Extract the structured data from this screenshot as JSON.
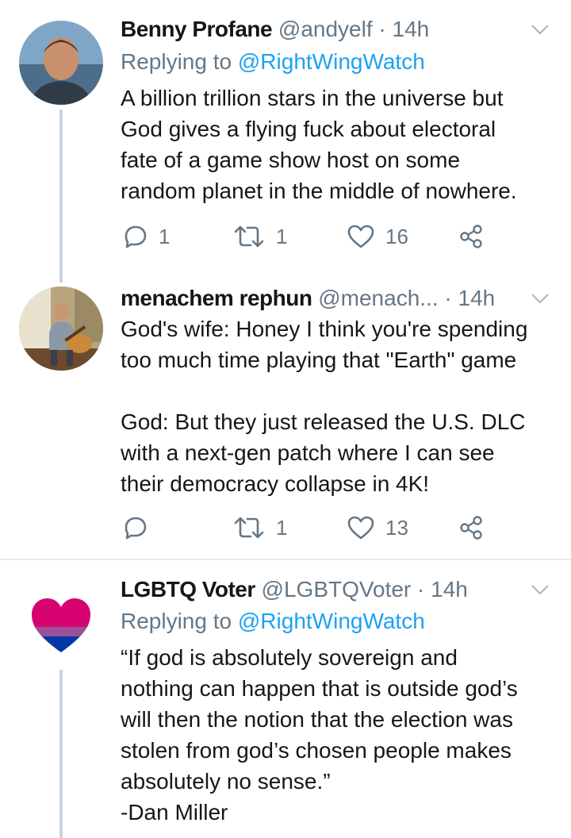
{
  "tweets": [
    {
      "name": "Benny Profane",
      "handle": "@andyelf",
      "separator": "·",
      "time": "14h",
      "replying_prefix": "Replying to",
      "replying_to": "@RightWingWatch",
      "text": "A billion trillion stars in the universe but\nGod gives a flying fuck about electoral\nfate of a game show host on some\nrandom planet in the middle of nowhere.",
      "replies": "1",
      "retweets": "1",
      "likes": "16"
    },
    {
      "name": "menachem rephun",
      "handle": "@menach...",
      "separator": "·",
      "time": "14h",
      "text": "God's wife: Honey I think you're spending\ntoo much time playing that \"Earth\" game\n\nGod: But they just released the U.S. DLC\nwith a next-gen patch where I can see\ntheir democracy collapse in 4K!",
      "replies": "",
      "retweets": "1",
      "likes": "13"
    },
    {
      "name": "LGBTQ Voter",
      "handle": "@LGBTQVoter",
      "separator": "·",
      "time": "14h",
      "replying_prefix": "Replying to",
      "replying_to": "@RightWingWatch",
      "text": "“If god is absolutely sovereign and\nnothing can happen that is outside god’s\nwill then the notion that the election was\nstolen from god’s chosen people makes\nabsolutely no sense.”\n-Dan Miller"
    }
  ],
  "icons": {
    "reply": "reply-icon",
    "retweet": "retweet-icon",
    "like": "heart-icon",
    "share": "share-icon",
    "menu": "chevron-down-icon"
  },
  "colors": {
    "link": "#1da1f2",
    "secondary_text": "#657786",
    "thread_line": "#c9d3dc",
    "heart_pink": "#d60270",
    "heart_purple": "#9b4f96",
    "heart_blue": "#0038a8"
  }
}
